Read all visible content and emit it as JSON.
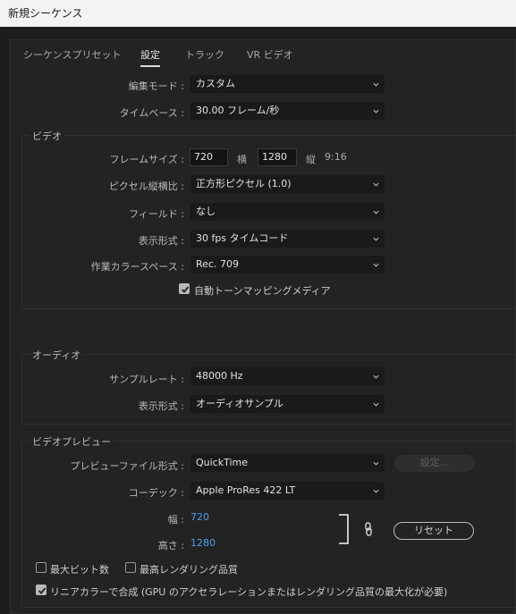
{
  "window": {
    "title": "新規シーケンス"
  },
  "tabs": [
    "シーケンスプリセット",
    "設定",
    "トラック",
    "VR ビデオ"
  ],
  "active_tab": "設定",
  "general": {
    "edit_mode_label": "編集モード :",
    "edit_mode_value": "カスタム",
    "timebase_label": "タイムベース :",
    "timebase_value": "30.00  フレーム/秒"
  },
  "video": {
    "section_title": "ビデオ",
    "frame_size_label": "フレームサイズ :",
    "width_value": "720",
    "width_unit": "横",
    "height_value": "1280",
    "height_unit": "縦",
    "aspect": "9:16",
    "pixel_aspect_label": "ピクセル縦横比 :",
    "pixel_aspect_value": "正方形ピクセル (1.0)",
    "fields_label": "フィールド :",
    "fields_value": "なし",
    "display_format_label": "表示形式 :",
    "display_format_value": "30 fps タイムコード",
    "working_color_space_label": "作業カラースペース :",
    "working_color_space_value": "Rec. 709",
    "auto_tone_mapping_label": "自動トーンマッピングメディア",
    "auto_tone_mapping_checked": true
  },
  "audio": {
    "section_title": "オーディオ",
    "sample_rate_label": "サンプルレート :",
    "sample_rate_value": "48000 Hz",
    "display_format_label": "表示形式 :",
    "display_format_value": "オーディオサンプル"
  },
  "video_preview": {
    "section_title": "ビデオプレビュー",
    "file_format_label": "プレビューファイル形式 :",
    "file_format_value": "QuickTime",
    "settings_button": "設定...",
    "codec_label": "コーデック :",
    "codec_value": "Apple ProRes 422 LT",
    "width_label": "幅 :",
    "width_value": "720",
    "height_label": "高さ :",
    "height_value": "1280",
    "reset_button": "リセット"
  },
  "options": {
    "max_bit_depth_label": "最大ビット数",
    "max_bit_depth_checked": false,
    "max_render_quality_label": "最高レンダリング品質",
    "max_render_quality_checked": false,
    "linear_color_label": "リニアカラーで合成 (GPU のアクセラレーションまたはレンダリング品質の最大化が必要)",
    "linear_color_checked": true
  },
  "colors": {
    "accent_blue": "#4c9fe8",
    "dialog_bg": "#232323",
    "field_bg": "#1a1a1a"
  },
  "icons": {
    "dropdown": "chevron-down-icon",
    "check": "checkmark-icon",
    "link": "chain-link-icon"
  }
}
